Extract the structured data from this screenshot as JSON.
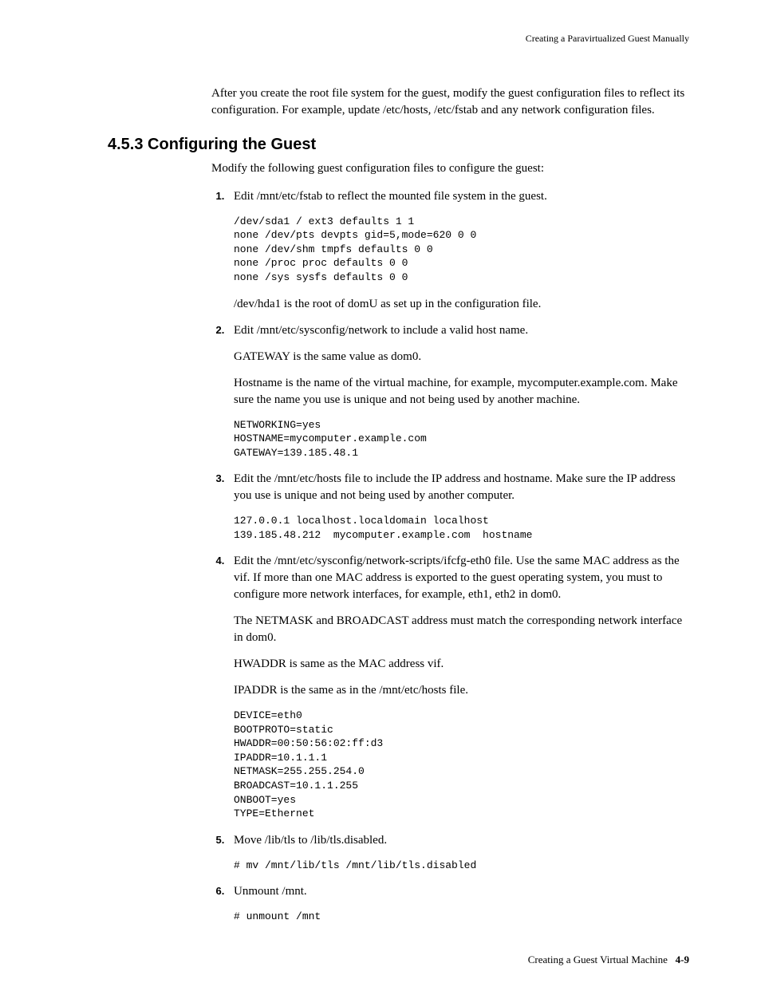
{
  "header": {
    "right_text": "Creating a Paravirtualized Guest Manually"
  },
  "intro": {
    "paragraph": "After you create the root file system for the guest, modify the guest configuration files to reflect its configuration. For example, update /etc/hosts, /etc/fstab and any network configuration files."
  },
  "section": {
    "number": "4.5.3",
    "title": "Configuring the Guest",
    "intro": "Modify the following guest configuration files to configure the guest:"
  },
  "steps": {
    "s1": {
      "text": "Edit /mnt/etc/fstab to reflect the mounted file system in the guest.",
      "code": "/dev/sda1 / ext3 defaults 1 1\nnone /dev/pts devpts gid=5,mode=620 0 0\nnone /dev/shm tmpfs defaults 0 0\nnone /proc proc defaults 0 0\nnone /sys sysfs defaults 0 0",
      "after": "/dev/hda1 is the root of domU as set up in the configuration file."
    },
    "s2": {
      "text": "Edit /mnt/etc/sysconfig/network to include a valid host name.",
      "p1": "GATEWAY is the same value as dom0.",
      "p2": "Hostname is the name of the virtual machine, for example, mycomputer.example.com. Make sure the name you use is unique and not being used by another machine.",
      "code": "NETWORKING=yes\nHOSTNAME=mycomputer.example.com\nGATEWAY=139.185.48.1"
    },
    "s3": {
      "text": "Edit the /mnt/etc/hosts file to include the IP address and hostname. Make sure the IP address you use is unique and not being used by another computer.",
      "code": "127.0.0.1 localhost.localdomain localhost\n139.185.48.212  mycomputer.example.com  hostname"
    },
    "s4": {
      "text": "Edit the /mnt/etc/sysconfig/network-scripts/ifcfg-eth0 file. Use the same MAC address as the vif. If more than one MAC address is exported to the guest operating system, you must to configure more network interfaces, for example, eth1, eth2 in dom0.",
      "p1": "The NETMASK and BROADCAST address must match the corresponding network interface in dom0.",
      "p2": "HWADDR is same as the MAC address vif.",
      "p3": "IPADDR is the same as in the /mnt/etc/hosts file.",
      "code": "DEVICE=eth0\nBOOTPROTO=static\nHWADDR=00:50:56:02:ff:d3\nIPADDR=10.1.1.1\nNETMASK=255.255.254.0\nBROADCAST=10.1.1.255\nONBOOT=yes\nTYPE=Ethernet"
    },
    "s5": {
      "text": "Move /lib/tls to /lib/tls.disabled.",
      "code": "# mv /mnt/lib/tls /mnt/lib/tls.disabled"
    },
    "s6": {
      "text": "Unmount /mnt.",
      "code": "# unmount /mnt"
    }
  },
  "footer": {
    "title": "Creating a Guest Virtual Machine",
    "pagenum": "4-9"
  }
}
